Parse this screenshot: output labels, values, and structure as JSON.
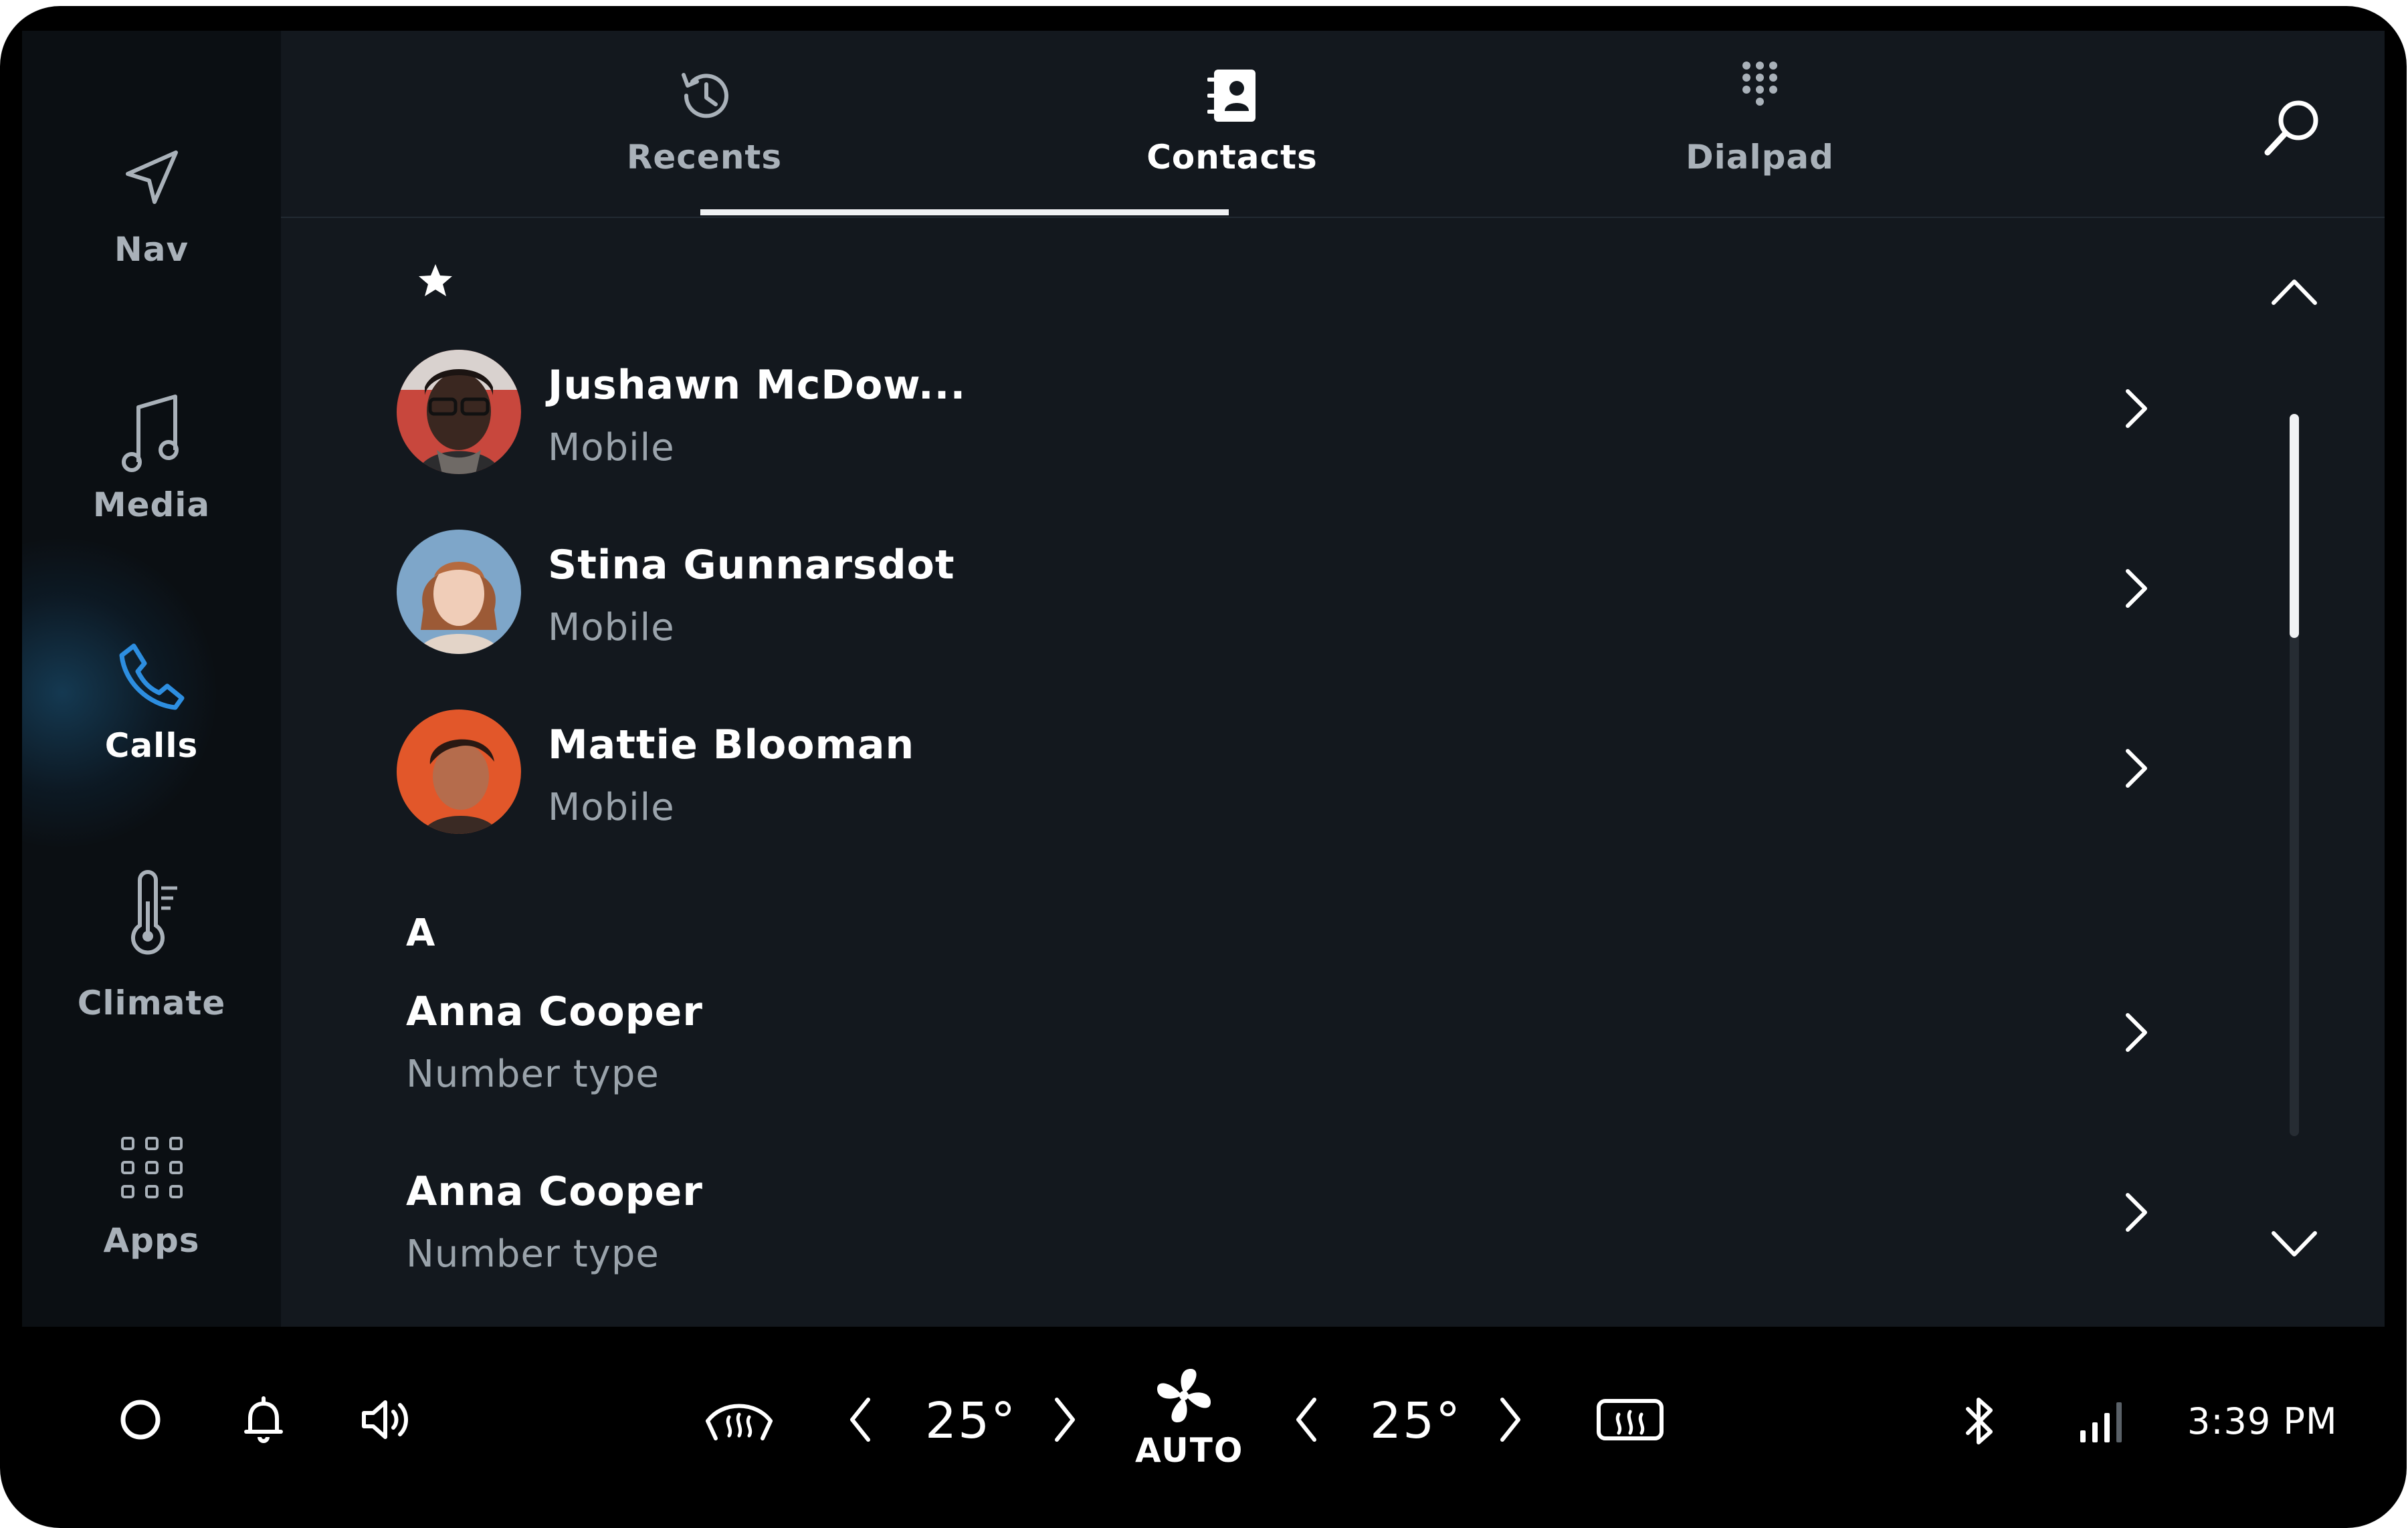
{
  "app": {
    "accent_color": "#2d8ee0",
    "background_color": "#13181e"
  },
  "nav_rail": {
    "items": [
      {
        "label": "Nav",
        "icon": "navigation-arrow-icon",
        "active": false
      },
      {
        "label": "Media",
        "icon": "music-note-icon",
        "active": false
      },
      {
        "label": "Calls",
        "icon": "phone-icon",
        "active": true
      },
      {
        "label": "Climate",
        "icon": "thermometer-icon",
        "active": false
      },
      {
        "label": "Apps",
        "icon": "app-grid-icon",
        "active": false
      }
    ]
  },
  "tabs": {
    "items": [
      {
        "label": "Recents",
        "icon": "history-icon",
        "selected": false
      },
      {
        "label": "Contacts",
        "icon": "contacts-book-icon",
        "selected": true
      },
      {
        "label": "Dialpad",
        "icon": "dialpad-icon",
        "selected": false
      }
    ],
    "search_icon": "search-icon"
  },
  "favorites": {
    "header_icon": "star-icon",
    "contacts": [
      {
        "name": "Jushawn McDow...",
        "number_type": "Mobile",
        "avatar": "photo"
      },
      {
        "name": "Stina Gunnarsdot",
        "number_type": "Mobile",
        "avatar": "photo"
      },
      {
        "name": "Mattie Blooman",
        "number_type": "Mobile",
        "avatar": "photo"
      }
    ]
  },
  "section_a": {
    "letter": "A",
    "contacts": [
      {
        "name": "Anna Cooper",
        "number_type": "Number type"
      },
      {
        "name": "Anna Cooper",
        "number_type": "Number type"
      }
    ]
  },
  "scroll": {
    "up_icon": "chevron-up-icon",
    "down_icon": "chevron-down-icon",
    "thumb_fraction": 0.31,
    "position_fraction": 0.0
  },
  "system_bar": {
    "left_icons": [
      "home-circle-icon",
      "notification-bell-icon",
      "volume-icon"
    ],
    "climate": {
      "left_temp": "25°",
      "right_temp": "25°",
      "fan_mode": "AUTO",
      "front_defrost_icon": "front-defrost-icon",
      "rear_defrost_icon": "rear-defrost-icon",
      "fan_icon": "fan-icon"
    },
    "status_icons": [
      "bluetooth-icon",
      "signal-strength-icon"
    ],
    "time": "3:39 PM"
  }
}
